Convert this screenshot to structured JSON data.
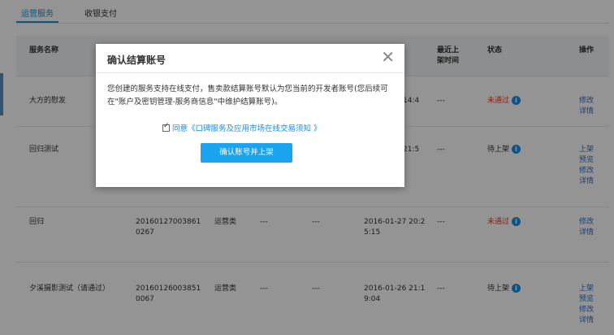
{
  "tabs": [
    {
      "label": "运营服务",
      "active": true
    },
    {
      "label": "收银支付",
      "active": false
    }
  ],
  "table": {
    "headers": {
      "name": "服务名称",
      "last_listed": "最近上架时间",
      "status": "状态",
      "actions": "操作"
    },
    "rows": [
      {
        "name": "大方的慰发",
        "id": "",
        "type": "",
        "c1": "",
        "c2": "",
        "time": "14:4",
        "last": "---",
        "status": "未通过",
        "status_type": "fail",
        "actions": [
          "修改",
          "详情"
        ]
      },
      {
        "name": "回归测试",
        "id": "",
        "type": "",
        "c1": "",
        "c2": "",
        "time": "21:5",
        "last": "---",
        "status": "待上架",
        "status_type": "pending",
        "actions": [
          "上架",
          "预览",
          "修改",
          "详情"
        ]
      },
      {
        "name": "回归",
        "id": "201601270038610267",
        "type": "运营类",
        "c1": "---",
        "c2": "---",
        "time": "2016-01-27 20:25:15",
        "last": "---",
        "status": "未通过",
        "status_type": "fail",
        "actions": [
          "修改",
          "详情"
        ]
      },
      {
        "name": "夕溪摄影测试（请通过）",
        "id": "201601260038510067",
        "type": "运营类",
        "c1": "---",
        "c2": "---",
        "time": "2016-01-26 21:19:04",
        "last": "---",
        "status": "待上架",
        "status_type": "pending",
        "actions": [
          "上架",
          "预览",
          "修改",
          "详情"
        ]
      }
    ]
  },
  "modal": {
    "title": "确认结算账号",
    "close_glyph": "✕",
    "body_text": "您创建的服务支持在线支付，售卖款结算账号默认为您当前的开发者账号(您后续可在\"账户及密钥管理-服务商信息\"中维护结算账号)。",
    "agree_prefix": "同意",
    "agree_link": "《口碑服务及应用市场在线交易须知 》",
    "agree_checked": true,
    "confirm_label": "确认账号并上架"
  },
  "colors": {
    "accent": "#1a90d9",
    "button": "#1aa3ee",
    "fail": "#e23b2e",
    "link": "#2a6fc9"
  }
}
